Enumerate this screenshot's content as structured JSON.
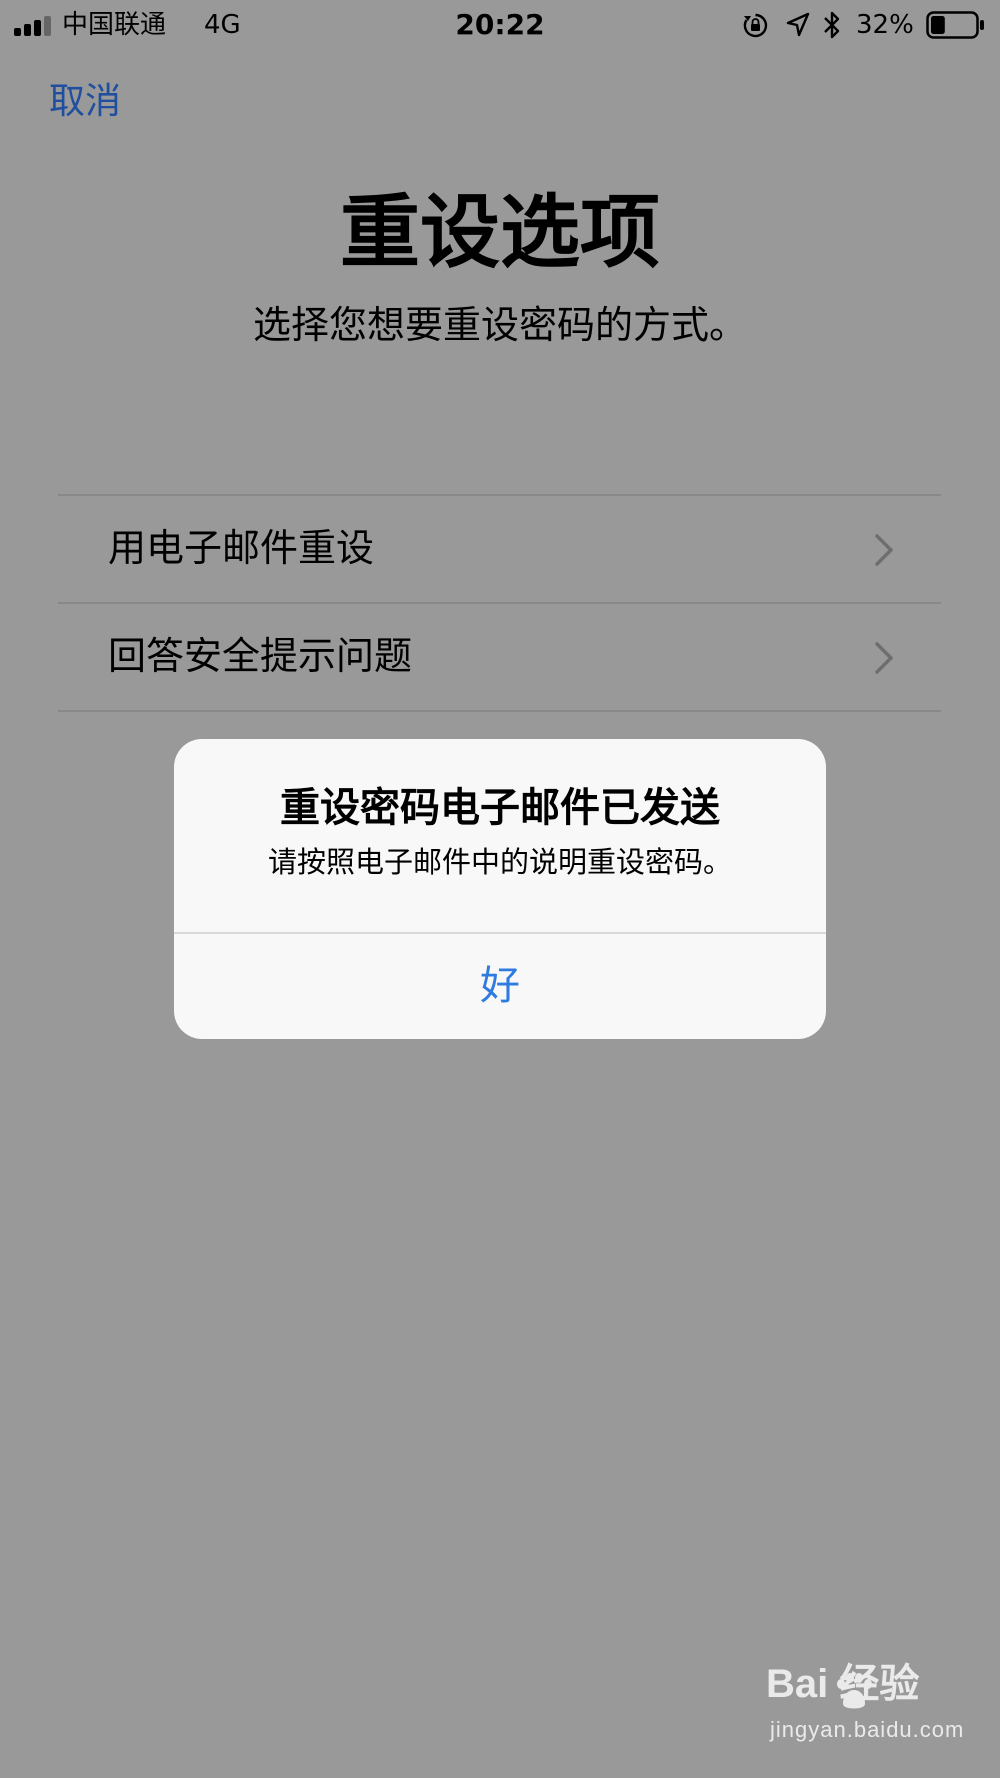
{
  "status_bar": {
    "carrier": "中国联通",
    "network": "4G",
    "time": "20:22",
    "battery_percent": "32%",
    "battery_level": 0.32,
    "icons": [
      "signal-icon",
      "rotation-lock-icon",
      "location-icon",
      "bluetooth-icon",
      "battery-icon"
    ]
  },
  "nav": {
    "cancel_label": "取消"
  },
  "page": {
    "title": "重设选项",
    "subtitle": "选择您想要重设密码的方式。"
  },
  "options": [
    {
      "label": "用电子邮件重设",
      "icon": "chevron-right-icon"
    },
    {
      "label": "回答安全提示问题",
      "icon": "chevron-right-icon"
    }
  ],
  "alert": {
    "title": "重设密码电子邮件已发送",
    "message": "请按照电子邮件中的说明重设密码。",
    "ok_label": "好"
  },
  "watermark": {
    "logo_text": "Bai  经验",
    "url": "jingyan.baidu.com"
  },
  "colors": {
    "dim_background": "#999999",
    "cancel_blue": "#1f4f9e",
    "alert_background": "#f8f8f8",
    "alert_button_blue": "#2f7bdf"
  }
}
